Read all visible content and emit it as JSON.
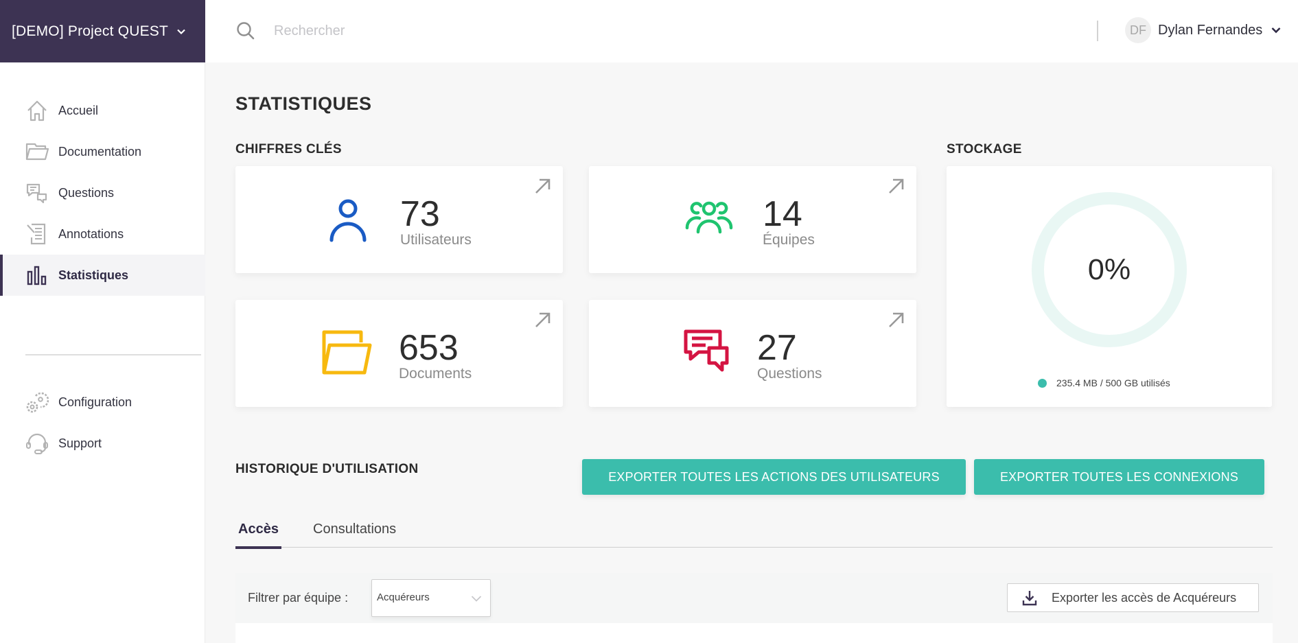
{
  "app": {
    "project_name": "[DEMO] Project QUEST"
  },
  "topbar": {
    "search_placeholder": "Rechercher",
    "user_initials": "DF",
    "user_name": "Dylan Fernandes"
  },
  "sidebar": {
    "items": [
      {
        "label": "Accueil",
        "icon": "home-icon",
        "active": false
      },
      {
        "label": "Documentation",
        "icon": "folder-icon",
        "active": false
      },
      {
        "label": "Questions",
        "icon": "chat-bubbles-icon",
        "active": false
      },
      {
        "label": "Annotations",
        "icon": "document-annotation-icon",
        "active": false
      },
      {
        "label": "Statistiques",
        "icon": "bar-chart-icon",
        "active": true
      }
    ],
    "bottom_items": [
      {
        "label": "Configuration",
        "icon": "gears-icon"
      },
      {
        "label": "Support",
        "icon": "headset-icon"
      }
    ]
  },
  "main": {
    "title": "STATISTIQUES",
    "key_figures": {
      "title": "CHIFFRES CLÉS",
      "cards": [
        {
          "value": "73",
          "label": "Utilisateurs",
          "icon": "user-icon",
          "color": "#1a5bc4"
        },
        {
          "value": "14",
          "label": "Équipes",
          "icon": "team-icon",
          "color": "#1fc46f"
        },
        {
          "value": "653",
          "label": "Documents",
          "icon": "folder-icon",
          "color": "#f7b90f"
        },
        {
          "value": "27",
          "label": "Questions",
          "icon": "chat-bubbles-icon",
          "color": "#d41442"
        }
      ]
    },
    "storage": {
      "title": "STOCKAGE",
      "percent_label": "0%",
      "used_fraction": 0.0,
      "legend": "235.4 MB / 500 GB utilisés",
      "accent_color": "#3bbdac",
      "track_color": "#e9f7f4"
    },
    "history": {
      "title": "HISTORIQUE D'UTILISATION",
      "export_actions_label": "EXPORTER TOUTES LES ACTIONS DES UTILISATEURS",
      "export_connections_label": "EXPORTER TOUTES LES CONNEXIONS",
      "tabs": [
        {
          "label": "Accès",
          "active": true
        },
        {
          "label": "Consultations",
          "active": false
        }
      ],
      "filter_label": "Filtrer par équipe :",
      "filter_value": "Acquéreurs",
      "export_access_label": "Exporter les accès de Acquéreurs"
    }
  },
  "colors": {
    "brand": "#3d3353",
    "teal": "#3bbdac"
  }
}
